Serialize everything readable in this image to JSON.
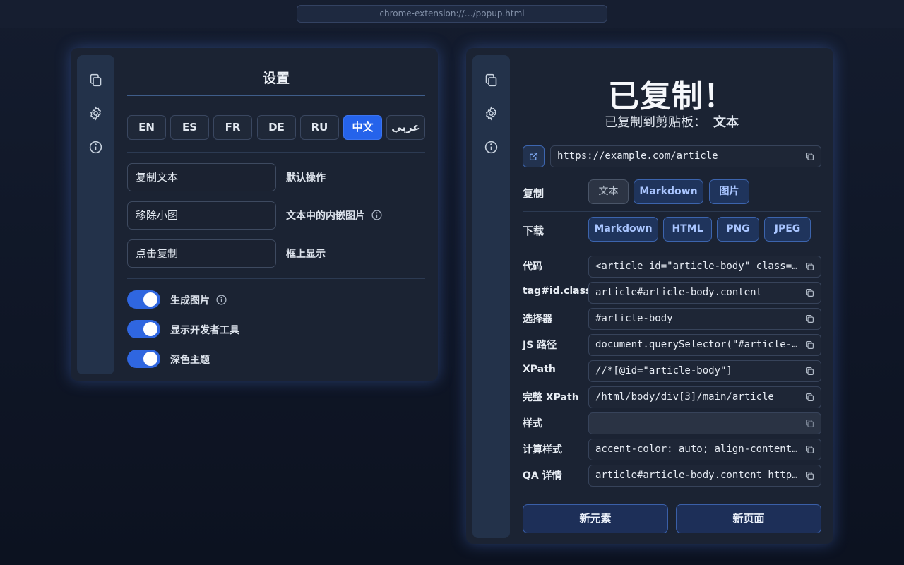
{
  "browser": {
    "url": "chrome-extension://…/popup.html"
  },
  "settings": {
    "title": "设置",
    "languages": [
      "EN",
      "ES",
      "FR",
      "DE",
      "RU",
      "中文",
      "عربي"
    ],
    "active_language": "中文",
    "options": [
      {
        "value": "复制文本",
        "label": "默认操作",
        "info": false
      },
      {
        "value": "移除小图",
        "label": "文本中的内嵌图片",
        "info": true
      },
      {
        "value": "点击复制",
        "label": "框上显示",
        "info": false
      }
    ],
    "toggles": [
      {
        "label": "生成图片",
        "on": true,
        "info": true
      },
      {
        "label": "显示开发者工具",
        "on": true,
        "info": false
      },
      {
        "label": "深色主题",
        "on": true,
        "info": false
      }
    ]
  },
  "sidebar": {
    "icons": [
      "copy-icon",
      "gear-icon",
      "info-icon"
    ]
  },
  "copied": {
    "title": "已复制！",
    "subtitle_prefix": "已复制到剪贴板：",
    "subtitle_value": "文本",
    "url": "https://example.com/article",
    "copy_label": "复制",
    "copy_options": [
      "文本",
      "Markdown",
      "图片"
    ],
    "download_label": "下载",
    "download_options": [
      "Markdown",
      "HTML",
      "PNG",
      "JPEG"
    ],
    "attributes": [
      {
        "label": "代码",
        "value": "<article id=\"article-body\" class=\"content\">"
      },
      {
        "label": "tag#id.class",
        "value": "article#article-body.content"
      },
      {
        "label": "选择器",
        "value": "#article-body"
      },
      {
        "label": "JS 路径",
        "value": "document.querySelector(\"#article-body\")"
      },
      {
        "label": "XPath",
        "value": "//*[@id=\"article-body\"]"
      },
      {
        "label": "完整 XPath",
        "value": "/html/body/div[3]/main/article"
      },
      {
        "label": "样式",
        "value": ""
      },
      {
        "label": "计算样式",
        "value": "accent-color: auto; align-content: normal;"
      },
      {
        "label": "QA 详情",
        "value": "article#article-body.content https://example.com/article"
      }
    ],
    "new_element_label": "新元素",
    "new_page_label": "新页面"
  },
  "colors": {
    "accent": "#2563eb",
    "panel": "#1b2333",
    "sidebar": "#23324a"
  }
}
